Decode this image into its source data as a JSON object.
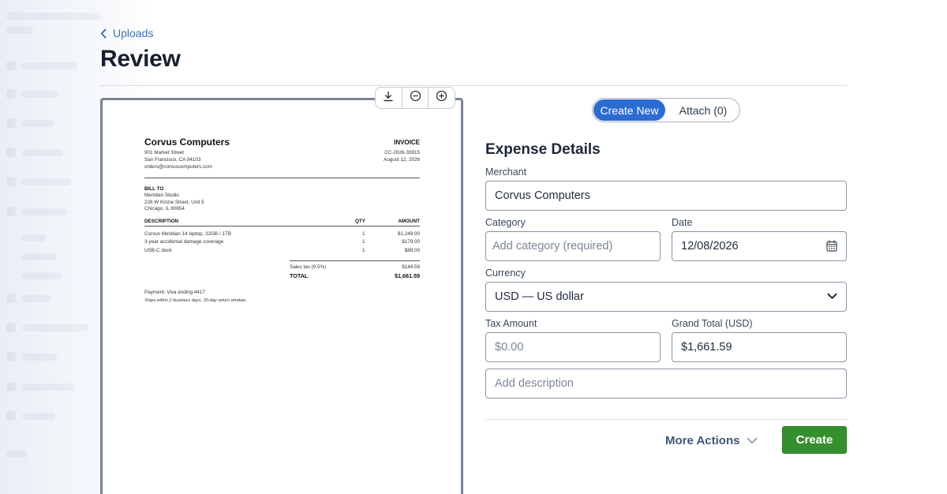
{
  "header": {
    "back_label": "Uploads",
    "title": "Review"
  },
  "document": {
    "company": "Corvus Computers",
    "company_address": [
      "901 Market Street",
      "San Francisco, CA 94103",
      "orders@corvuscomputers.com"
    ],
    "doc_label": "INVOICE",
    "invoice_number": "CC-2026-33915",
    "invoice_date": "August 12, 2026",
    "bill_to_heading": "BILL TO",
    "bill_to": [
      "Meridian Studio",
      "228 W Kinzie Street, Unit 5",
      "Chicago, IL 60654"
    ],
    "columns": {
      "description": "DESCRIPTION",
      "qty": "QTY",
      "amount": "AMOUNT"
    },
    "items": [
      {
        "description": "Corvus Meridian 14 laptop, 32GB / 1TB",
        "qty": "1",
        "amount": "$1,249.00"
      },
      {
        "description": "3-year accidental damage coverage",
        "qty": "1",
        "amount": "$179.00"
      },
      {
        "description": "USB-C dock",
        "qty": "1",
        "amount": "$89.00"
      }
    ],
    "tax_label": "Sales tax (9.5%)",
    "tax_value": "$144.59",
    "total_label": "TOTAL",
    "total_value": "$1,661.59",
    "payment": "Payment: Visa ending 4417",
    "note": "Ships within 2 business days. 30-day return window."
  },
  "toggle": {
    "create_label": "Create New",
    "attach_label": "Attach (0)"
  },
  "form": {
    "section_title": "Expense Details",
    "merchant_label": "Merchant",
    "merchant_value": "Corvus Computers",
    "category_label": "Category",
    "category_placeholder": "Add category (required)",
    "date_label": "Date",
    "date_value": "12/08/2026",
    "currency_label": "Currency",
    "currency_value": "USD — US dollar",
    "tax_label": "Tax Amount",
    "tax_placeholder": "$0.00",
    "total_label": "Grand Total (USD)",
    "total_value": "$1,661.59",
    "description_placeholder": "Add description"
  },
  "actions": {
    "more_label": "More Actions",
    "create_label": "Create"
  },
  "colors": {
    "accent_blue": "#2c6cd0",
    "link_blue": "#3f6fb5",
    "create_green": "#358f2e"
  }
}
